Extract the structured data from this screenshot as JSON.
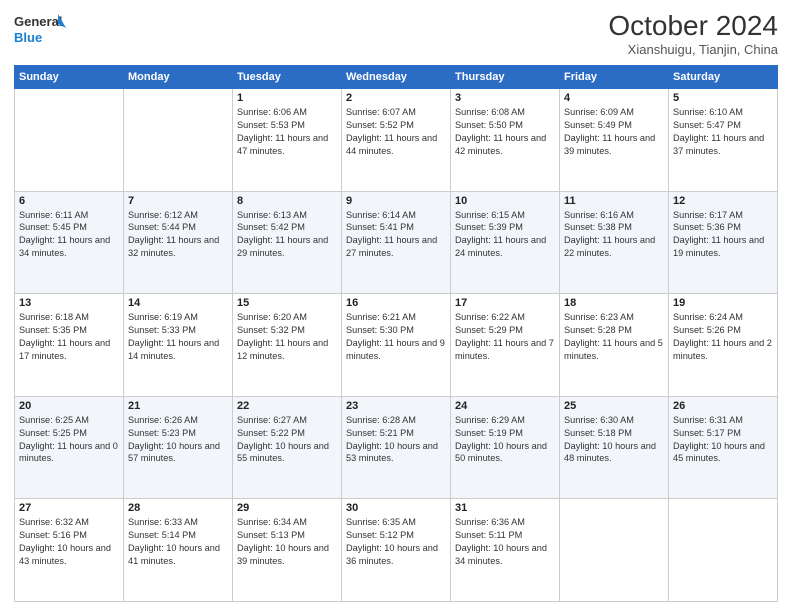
{
  "header": {
    "logo_line1": "General",
    "logo_line2": "Blue",
    "month": "October 2024",
    "location": "Xianshuigu, Tianjin, China"
  },
  "weekdays": [
    "Sunday",
    "Monday",
    "Tuesday",
    "Wednesday",
    "Thursday",
    "Friday",
    "Saturday"
  ],
  "weeks": [
    [
      {
        "day": "",
        "sunrise": "",
        "sunset": "",
        "daylight": ""
      },
      {
        "day": "",
        "sunrise": "",
        "sunset": "",
        "daylight": ""
      },
      {
        "day": "1",
        "sunrise": "Sunrise: 6:06 AM",
        "sunset": "Sunset: 5:53 PM",
        "daylight": "Daylight: 11 hours and 47 minutes."
      },
      {
        "day": "2",
        "sunrise": "Sunrise: 6:07 AM",
        "sunset": "Sunset: 5:52 PM",
        "daylight": "Daylight: 11 hours and 44 minutes."
      },
      {
        "day": "3",
        "sunrise": "Sunrise: 6:08 AM",
        "sunset": "Sunset: 5:50 PM",
        "daylight": "Daylight: 11 hours and 42 minutes."
      },
      {
        "day": "4",
        "sunrise": "Sunrise: 6:09 AM",
        "sunset": "Sunset: 5:49 PM",
        "daylight": "Daylight: 11 hours and 39 minutes."
      },
      {
        "day": "5",
        "sunrise": "Sunrise: 6:10 AM",
        "sunset": "Sunset: 5:47 PM",
        "daylight": "Daylight: 11 hours and 37 minutes."
      }
    ],
    [
      {
        "day": "6",
        "sunrise": "Sunrise: 6:11 AM",
        "sunset": "Sunset: 5:45 PM",
        "daylight": "Daylight: 11 hours and 34 minutes."
      },
      {
        "day": "7",
        "sunrise": "Sunrise: 6:12 AM",
        "sunset": "Sunset: 5:44 PM",
        "daylight": "Daylight: 11 hours and 32 minutes."
      },
      {
        "day": "8",
        "sunrise": "Sunrise: 6:13 AM",
        "sunset": "Sunset: 5:42 PM",
        "daylight": "Daylight: 11 hours and 29 minutes."
      },
      {
        "day": "9",
        "sunrise": "Sunrise: 6:14 AM",
        "sunset": "Sunset: 5:41 PM",
        "daylight": "Daylight: 11 hours and 27 minutes."
      },
      {
        "day": "10",
        "sunrise": "Sunrise: 6:15 AM",
        "sunset": "Sunset: 5:39 PM",
        "daylight": "Daylight: 11 hours and 24 minutes."
      },
      {
        "day": "11",
        "sunrise": "Sunrise: 6:16 AM",
        "sunset": "Sunset: 5:38 PM",
        "daylight": "Daylight: 11 hours and 22 minutes."
      },
      {
        "day": "12",
        "sunrise": "Sunrise: 6:17 AM",
        "sunset": "Sunset: 5:36 PM",
        "daylight": "Daylight: 11 hours and 19 minutes."
      }
    ],
    [
      {
        "day": "13",
        "sunrise": "Sunrise: 6:18 AM",
        "sunset": "Sunset: 5:35 PM",
        "daylight": "Daylight: 11 hours and 17 minutes."
      },
      {
        "day": "14",
        "sunrise": "Sunrise: 6:19 AM",
        "sunset": "Sunset: 5:33 PM",
        "daylight": "Daylight: 11 hours and 14 minutes."
      },
      {
        "day": "15",
        "sunrise": "Sunrise: 6:20 AM",
        "sunset": "Sunset: 5:32 PM",
        "daylight": "Daylight: 11 hours and 12 minutes."
      },
      {
        "day": "16",
        "sunrise": "Sunrise: 6:21 AM",
        "sunset": "Sunset: 5:30 PM",
        "daylight": "Daylight: 11 hours and 9 minutes."
      },
      {
        "day": "17",
        "sunrise": "Sunrise: 6:22 AM",
        "sunset": "Sunset: 5:29 PM",
        "daylight": "Daylight: 11 hours and 7 minutes."
      },
      {
        "day": "18",
        "sunrise": "Sunrise: 6:23 AM",
        "sunset": "Sunset: 5:28 PM",
        "daylight": "Daylight: 11 hours and 5 minutes."
      },
      {
        "day": "19",
        "sunrise": "Sunrise: 6:24 AM",
        "sunset": "Sunset: 5:26 PM",
        "daylight": "Daylight: 11 hours and 2 minutes."
      }
    ],
    [
      {
        "day": "20",
        "sunrise": "Sunrise: 6:25 AM",
        "sunset": "Sunset: 5:25 PM",
        "daylight": "Daylight: 11 hours and 0 minutes."
      },
      {
        "day": "21",
        "sunrise": "Sunrise: 6:26 AM",
        "sunset": "Sunset: 5:23 PM",
        "daylight": "Daylight: 10 hours and 57 minutes."
      },
      {
        "day": "22",
        "sunrise": "Sunrise: 6:27 AM",
        "sunset": "Sunset: 5:22 PM",
        "daylight": "Daylight: 10 hours and 55 minutes."
      },
      {
        "day": "23",
        "sunrise": "Sunrise: 6:28 AM",
        "sunset": "Sunset: 5:21 PM",
        "daylight": "Daylight: 10 hours and 53 minutes."
      },
      {
        "day": "24",
        "sunrise": "Sunrise: 6:29 AM",
        "sunset": "Sunset: 5:19 PM",
        "daylight": "Daylight: 10 hours and 50 minutes."
      },
      {
        "day": "25",
        "sunrise": "Sunrise: 6:30 AM",
        "sunset": "Sunset: 5:18 PM",
        "daylight": "Daylight: 10 hours and 48 minutes."
      },
      {
        "day": "26",
        "sunrise": "Sunrise: 6:31 AM",
        "sunset": "Sunset: 5:17 PM",
        "daylight": "Daylight: 10 hours and 45 minutes."
      }
    ],
    [
      {
        "day": "27",
        "sunrise": "Sunrise: 6:32 AM",
        "sunset": "Sunset: 5:16 PM",
        "daylight": "Daylight: 10 hours and 43 minutes."
      },
      {
        "day": "28",
        "sunrise": "Sunrise: 6:33 AM",
        "sunset": "Sunset: 5:14 PM",
        "daylight": "Daylight: 10 hours and 41 minutes."
      },
      {
        "day": "29",
        "sunrise": "Sunrise: 6:34 AM",
        "sunset": "Sunset: 5:13 PM",
        "daylight": "Daylight: 10 hours and 39 minutes."
      },
      {
        "day": "30",
        "sunrise": "Sunrise: 6:35 AM",
        "sunset": "Sunset: 5:12 PM",
        "daylight": "Daylight: 10 hours and 36 minutes."
      },
      {
        "day": "31",
        "sunrise": "Sunrise: 6:36 AM",
        "sunset": "Sunset: 5:11 PM",
        "daylight": "Daylight: 10 hours and 34 minutes."
      },
      {
        "day": "",
        "sunrise": "",
        "sunset": "",
        "daylight": ""
      },
      {
        "day": "",
        "sunrise": "",
        "sunset": "",
        "daylight": ""
      }
    ]
  ]
}
